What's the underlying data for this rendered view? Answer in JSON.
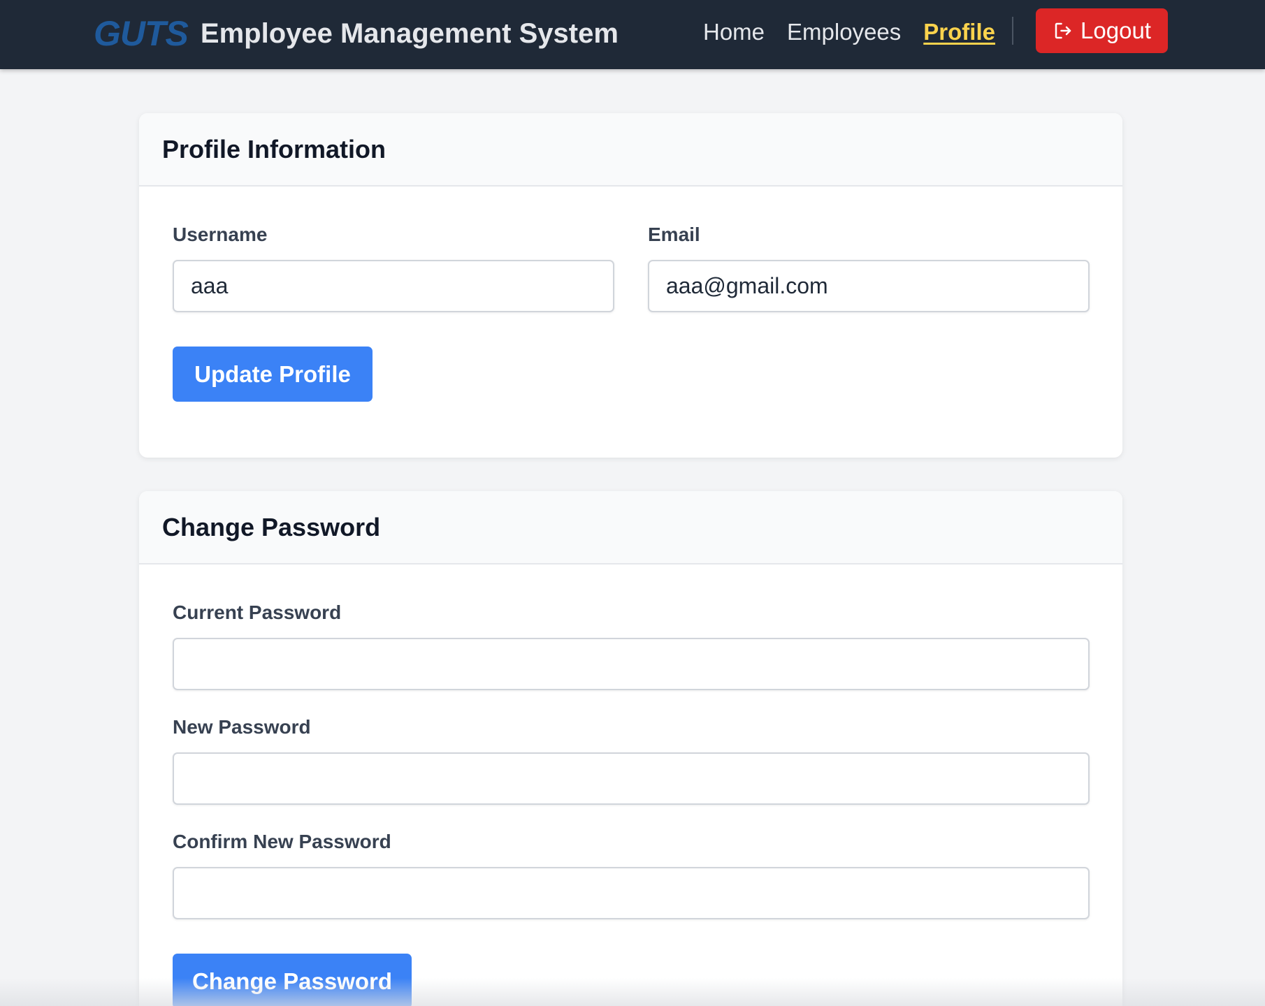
{
  "navbar": {
    "logo_text": "GUTS",
    "brand_title": "Employee Management System",
    "links": [
      "Home",
      "Employees",
      "Profile"
    ],
    "active_link": "Profile",
    "logout_label": "Logout"
  },
  "colors": {
    "navbar_bg": "#1f2937",
    "active_link": "#fcd34d",
    "logout_bg": "#dc2626",
    "primary_button": "#3b82f6"
  },
  "profile_info": {
    "title": "Profile Information",
    "username_label": "Username",
    "username_value": "aaa",
    "email_label": "Email",
    "email_value": "aaa@gmail.com",
    "submit_label": "Update Profile"
  },
  "change_password": {
    "title": "Change Password",
    "current_label": "Current Password",
    "new_label": "New Password",
    "confirm_label": "Confirm New Password",
    "submit_label": "Change Password"
  }
}
